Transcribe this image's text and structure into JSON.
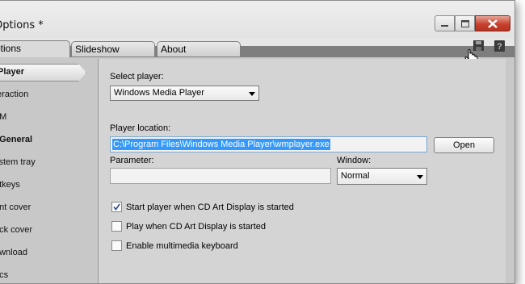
{
  "window": {
    "title": "Options *",
    "buttons": {
      "minimize": "minimize-icon",
      "maximize": "maximize-icon",
      "close": "close-icon"
    }
  },
  "tabs": [
    {
      "label": "ptions",
      "active": true
    },
    {
      "label": "Slideshow",
      "active": false
    },
    {
      "label": "About",
      "active": false
    }
  ],
  "toolbar": {
    "save_icon": "save-icon",
    "help_icon": "help-icon"
  },
  "sidebar": {
    "items": [
      {
        "label": "Player",
        "bold": true,
        "selected": true
      },
      {
        "label": "teraction"
      },
      {
        "label": "LM"
      },
      {
        "label": "/ General",
        "bold": true
      },
      {
        "label": "ystem tray"
      },
      {
        "label": "otkeys"
      },
      {
        "label": "ont cover"
      },
      {
        "label": "ack cover"
      },
      {
        "label": "ownload"
      },
      {
        "label": "rics"
      }
    ]
  },
  "main": {
    "select_player_label": "Select player:",
    "player_select_value": "Windows Media Player",
    "player_location_label": "Player location:",
    "player_location_value": "C:\\Program Files\\Windows Media Player\\wmplayer.exe",
    "open_button": "Open",
    "parameter_label": "Parameter:",
    "parameter_value": "",
    "window_label": "Window:",
    "window_select_value": "Normal",
    "checkboxes": [
      {
        "label": "Start player when CD Art Display is started",
        "checked": true
      },
      {
        "label": "Play when CD Art Display is started",
        "checked": false
      },
      {
        "label": "Enable multimedia keyboard",
        "checked": false
      }
    ]
  },
  "colors": {
    "selection": "#3399ff",
    "close_button": "#c7422e"
  }
}
